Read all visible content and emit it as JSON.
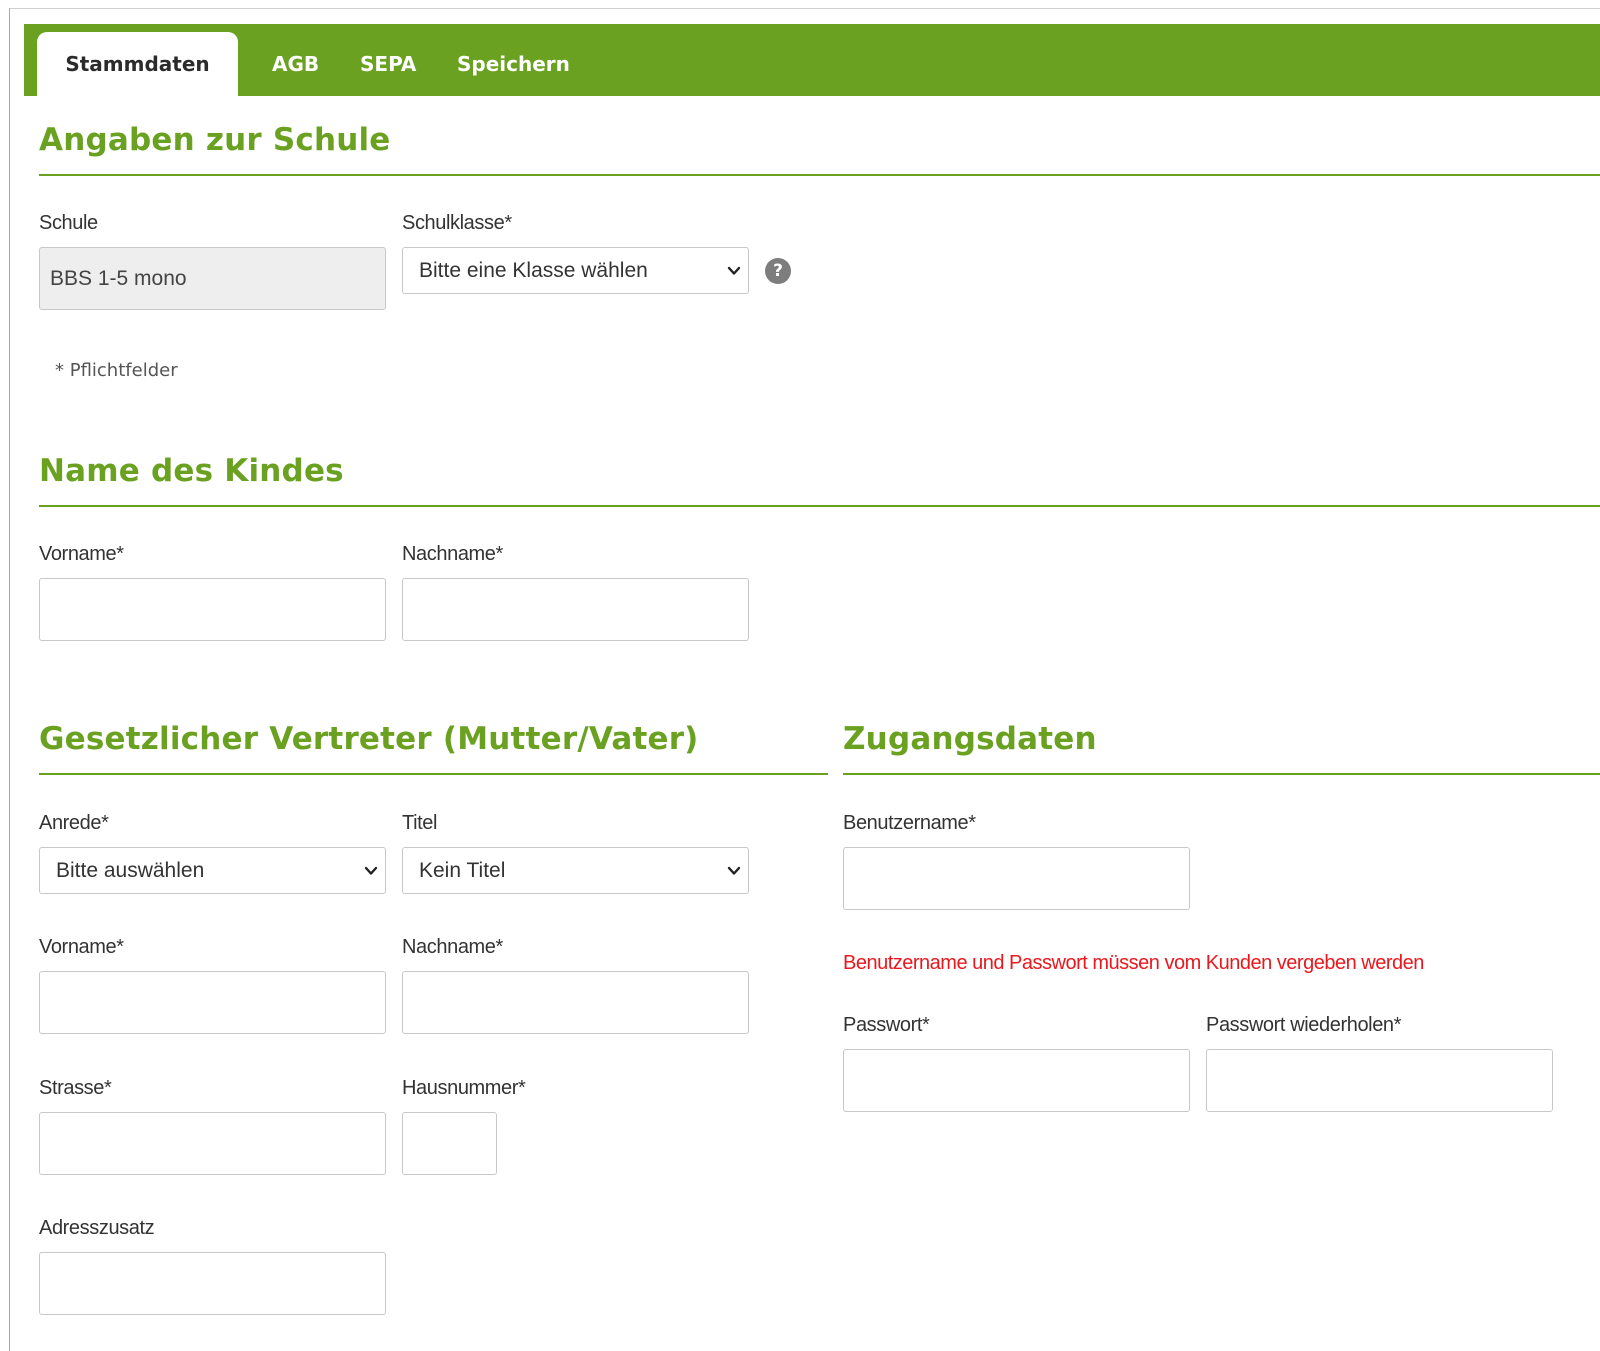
{
  "tabs": [
    {
      "label": "Stammdaten",
      "active": true
    },
    {
      "label": "AGB",
      "active": false
    },
    {
      "label": "SEPA",
      "active": false
    },
    {
      "label": "Speichern",
      "active": false
    }
  ],
  "colors": {
    "accent": "#6aa121",
    "warning": "#e8191e"
  },
  "schule_section": {
    "title": "Angaben zur Schule",
    "schule_label": "Schule",
    "schule_value": "BBS 1-5 mono",
    "klasse_label": "Schulklasse*",
    "klasse_value": "Bitte eine Klasse wählen",
    "help_icon": "?",
    "required_note": "* Pflichtfelder"
  },
  "kind_section": {
    "title": "Name des Kindes",
    "vorname_label": "Vorname*",
    "nachname_label": "Nachname*"
  },
  "vertreter_section": {
    "title": "Gesetzlicher Vertreter (Mutter/Vater)",
    "anrede_label": "Anrede*",
    "anrede_value": "Bitte auswählen",
    "titel_label": "Titel",
    "titel_value": "Kein Titel",
    "vorname_label": "Vorname*",
    "nachname_label": "Nachname*",
    "strasse_label": "Strasse*",
    "hausnummer_label": "Hausnummer*",
    "adresszusatz_label": "Adresszusatz"
  },
  "zugang_section": {
    "title": "Zugangsdaten",
    "benutzername_label": "Benutzername*",
    "warning": "Benutzername und Passwort müssen vom Kunden vergeben werden",
    "passwort_label": "Passwort*",
    "passwort_repeat_label": "Passwort wiederholen*"
  }
}
